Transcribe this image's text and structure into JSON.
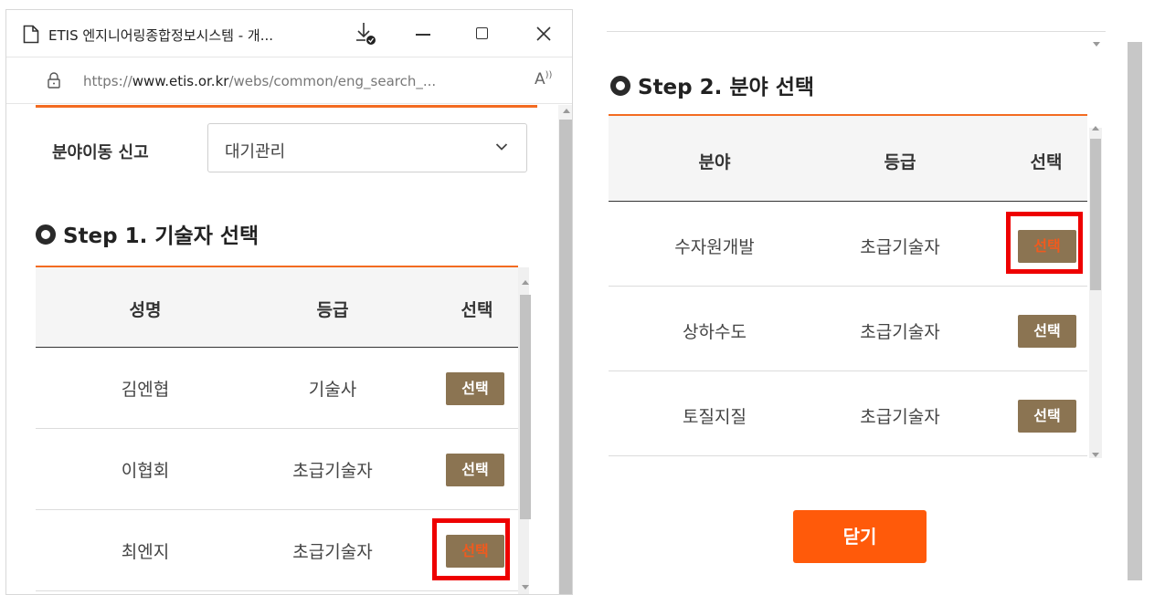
{
  "browser": {
    "tab_title": "ETIS 엔지니어링종합정보시스템 - 개...",
    "url_prefix": "https://",
    "url_host": "www.etis.or.kr",
    "url_path": "/webs/common/eng_search_...",
    "reader_label": "A",
    "icons": [
      "page-icon",
      "download-icon",
      "minimize-icon",
      "maximize-icon",
      "close-icon",
      "lock-icon",
      "reader-mode-icon"
    ]
  },
  "left": {
    "move_label": "분야이동 신고",
    "select_value": "대기관리",
    "step1_title": "Step 1. 기술자 선택",
    "headers": [
      "성명",
      "등급",
      "선택"
    ],
    "rows": [
      {
        "name": "김엔협",
        "grade": "기술사",
        "button": "선택"
      },
      {
        "name": "이협회",
        "grade": "초급기술자",
        "button": "선택"
      },
      {
        "name": "최엔지",
        "grade": "초급기술자",
        "button": "선택"
      }
    ],
    "highlighted_row": 2
  },
  "right": {
    "step2_title": "Step 2. 분야 선택",
    "headers": [
      "분야",
      "등급",
      "선택"
    ],
    "rows": [
      {
        "field": "수자원개발",
        "grade": "초급기술자",
        "button": "선택"
      },
      {
        "field": "상하수도",
        "grade": "초급기술자",
        "button": "선택"
      },
      {
        "field": "토질지질",
        "grade": "초급기술자",
        "button": "선택"
      }
    ],
    "highlighted_row": 0,
    "close_label": "닫기"
  },
  "colors": {
    "accent_orange": "#f36b21",
    "select_button": "#8b7452",
    "highlight_border": "#ee0000",
    "close_button": "#ff5a0a"
  }
}
